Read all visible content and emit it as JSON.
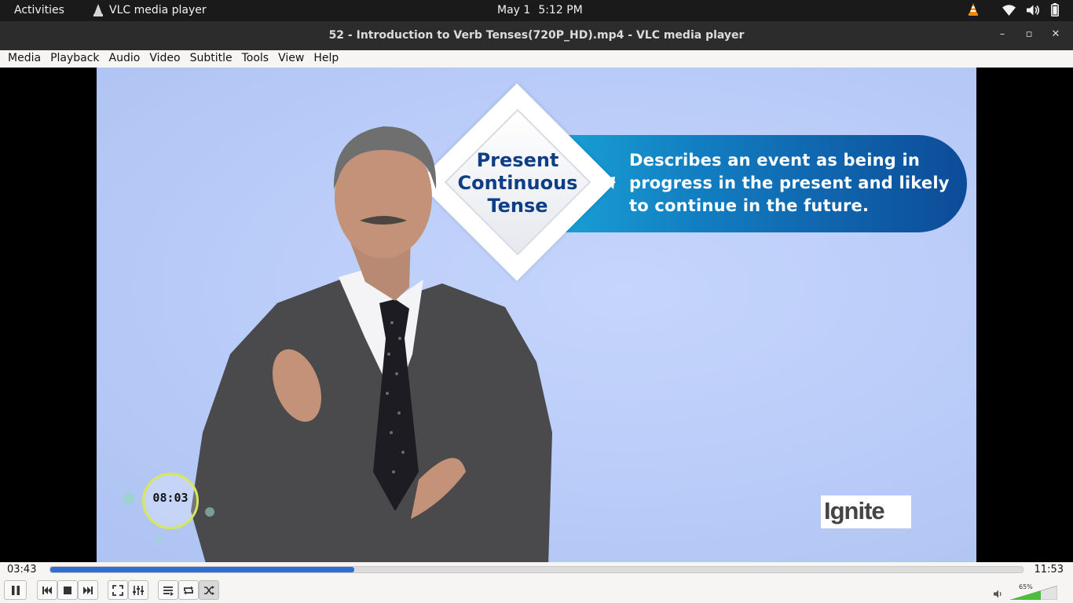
{
  "topbar": {
    "activities": "Activities",
    "app_name": "VLC media player",
    "date": "May 1",
    "time": "5:12 PM",
    "tray_icons": [
      "vlc-cone-icon",
      "wifi-icon",
      "speaker-icon",
      "battery-icon"
    ]
  },
  "window": {
    "title": "52 - Introduction to Verb Tenses(720P_HD).mp4 - VLC media player",
    "controls": [
      "minimize-icon",
      "maximize-icon",
      "close-icon"
    ]
  },
  "menu": {
    "items": [
      "Media",
      "Playback",
      "Audio",
      "Video",
      "Subtitle",
      "Tools",
      "View",
      "Help"
    ]
  },
  "video": {
    "heading_lines": [
      "Present",
      "Continuous",
      "Tense"
    ],
    "description_lines": [
      "Describes an event as being in",
      "progress in the present and likely",
      "to continue in the future."
    ],
    "countdown": "08:03",
    "logo": "Ignite"
  },
  "playback": {
    "elapsed": "03:43",
    "total": "11:53",
    "progress_fraction": 0.313,
    "volume_label": "65%",
    "volume_fraction": 0.65
  },
  "colors": {
    "accent": "#2f6ecf",
    "banner_dark": "#0d4b98",
    "banner_light": "#1aa6d8",
    "heading_text": "#0e3f86",
    "background_blue": "#b9cbf8",
    "volume_green": "#4cbf3a"
  }
}
